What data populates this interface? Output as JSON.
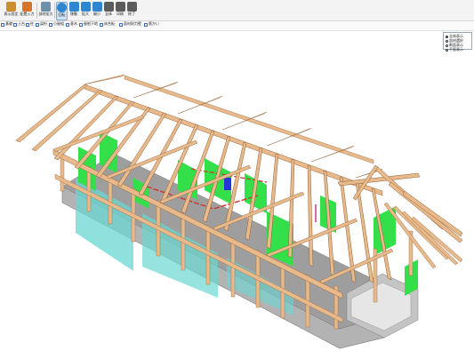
{
  "toolbar": {
    "buttons": [
      {
        "label": "表示設定",
        "icon": "display-settings-icon",
        "color": "#c8902e"
      },
      {
        "label": "配置入力",
        "icon": "layout-input-icon",
        "color": "#d5742c"
      },
      {
        "label": "部材拡大",
        "icon": "member-zoom-icon",
        "color": "#6f8fa8"
      },
      {
        "label": "回転",
        "icon": "rotate-icon",
        "color": "#2f86cf",
        "active": true
      },
      {
        "label": "移動",
        "icon": "move-icon",
        "color": "#2f86cf"
      },
      {
        "label": "拡大",
        "icon": "zoom-in-icon",
        "color": "#2f86cf"
      },
      {
        "label": "縮小",
        "icon": "zoom-out-icon",
        "color": "#2f86cf"
      },
      {
        "label": "全体",
        "icon": "fit-icon",
        "color": "#5b5b5b"
      },
      {
        "label": "印刷",
        "icon": "print-icon",
        "color": "#5b5b5b"
      },
      {
        "label": "終了",
        "icon": "exit-icon",
        "color": "#5b5b5b"
      }
    ]
  },
  "subbar": {
    "items": [
      "基礎",
      "土台",
      "柱",
      "梁桁",
      "小屋組",
      "垂木",
      "屋根下地",
      "床合板",
      "面材耐力壁",
      "筋かい"
    ]
  },
  "view_panel": {
    "options": [
      {
        "label": "全体表示",
        "selected": true
      },
      {
        "label": "部材選択",
        "selected": false
      },
      {
        "label": "断面表示",
        "selected": false
      },
      {
        "label": "平面表示",
        "selected": false
      }
    ]
  },
  "colors": {
    "timber": "#e8b98a",
    "timber_edge": "#9a6a3f",
    "panel_green": "#33e04a",
    "glass_cyan": "#69d7d2",
    "foundation": "#a7a7a7"
  }
}
